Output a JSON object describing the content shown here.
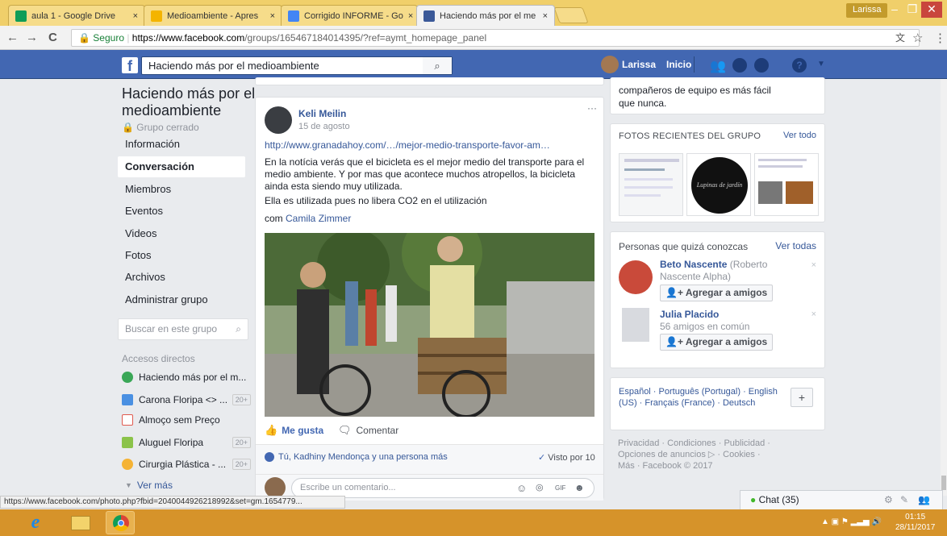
{
  "browser": {
    "tabs": [
      {
        "title": "aula 1 - Google Drive",
        "favicon_color": "#0f9d58"
      },
      {
        "title": "Medioambiente - Apres",
        "favicon_color": "#f4b400"
      },
      {
        "title": "Corrigido INFORME - Go",
        "favicon_color": "#4285f4"
      },
      {
        "title": "Haciendo más por el me",
        "favicon_color": "#3b5998",
        "active": true
      }
    ],
    "tab_close": "×",
    "user": "Larissa",
    "win_min": "–",
    "win_max": "❐",
    "win_close": "✕",
    "back": "←",
    "forward": "→",
    "reload": "C",
    "secure_label": "Seguro",
    "url_host": "https://www.facebook.com",
    "url_path": "/groups/165467184014395/?ref=aymt_homepage_panel",
    "translate_icon": "文",
    "star_icon": "☆",
    "menu_icon": "⋮"
  },
  "fb": {
    "search_value": "Haciendo más por el medioambiente",
    "user": "Larissa",
    "home": "Inicio",
    "accent": "#4267b2"
  },
  "group": {
    "title": "Haciendo más por el medioambiente",
    "privacy": "Grupo cerrado",
    "nav": [
      "Información",
      "Conversación",
      "Miembros",
      "Eventos",
      "Videos",
      "Fotos",
      "Archivos",
      "Administrar grupo"
    ],
    "search_placeholder": "Buscar en este grupo",
    "shortcuts_title": "Accesos directos",
    "shortcuts": [
      {
        "label": "Haciendo más por el m...",
        "count": ""
      },
      {
        "label": "Carona Floripa <> ...",
        "count": "20+"
      },
      {
        "label": "Almoço sem Preço",
        "count": ""
      },
      {
        "label": "Aluguel Floripa",
        "count": "20+"
      },
      {
        "label": "Cirurgia Plástica - ...",
        "count": "20+"
      }
    ],
    "more": "Ver más"
  },
  "post": {
    "author": "Keli Meilin",
    "date": "15 de agosto",
    "options": "···",
    "link": "http://www.granadahoy.com/…/mejor-medio-transporte-favor-am…",
    "text1": "En la notícia verás que el bicicleta es el mejor medio del transporte para el medio ambiente. Y por mas que acontece muchos atropellos, la bicicleta ainda esta siendo muy utilizada.",
    "text2": "Ella es utilizada pues no libera CO2 en el utilización",
    "with_prefix": "com",
    "with_name": "Camila Zimmer",
    "like": "Me gusta",
    "comment": "Comentar",
    "reactions": "Tú, Kadhiny Mendonça y una persona más",
    "seen": "Visto por 10",
    "comment_placeholder": "Escribe un comentario..."
  },
  "right": {
    "top_text": "compañeros de equipo es más fácil que nunca.",
    "photos_title": "FOTOS RECIENTES DEL GRUPO",
    "photos_link": "Ver todo",
    "photo_mid_text": "Lupinas de jardín",
    "pymk_title": "Personas que quizá conozcas",
    "pymk_link": "Ver todas",
    "people": [
      {
        "name": "Beto Nascente",
        "extra": "(Roberto Nascente Alpha)",
        "add": "Agregar a amigos"
      },
      {
        "name": "Julia Placido",
        "extra": "56 amigos en común",
        "add": "Agregar a amigos"
      }
    ],
    "langs": "Español · Português (Portugal) · English (US) · Français (France) · Deutsch",
    "lang_plus": "+",
    "footer": "Privacidad · Condiciones · Publicidad · Opciones de anuncios ▷ · Cookies · Más · Facebook © 2017"
  },
  "chat": {
    "label": "Chat (35)"
  },
  "statusbar": "https://www.facebook.com/photo.php?fbid=2040044926218992&set=gm.1654779...",
  "taskbar": {
    "time": "01:15",
    "date": "28/11/2017"
  }
}
